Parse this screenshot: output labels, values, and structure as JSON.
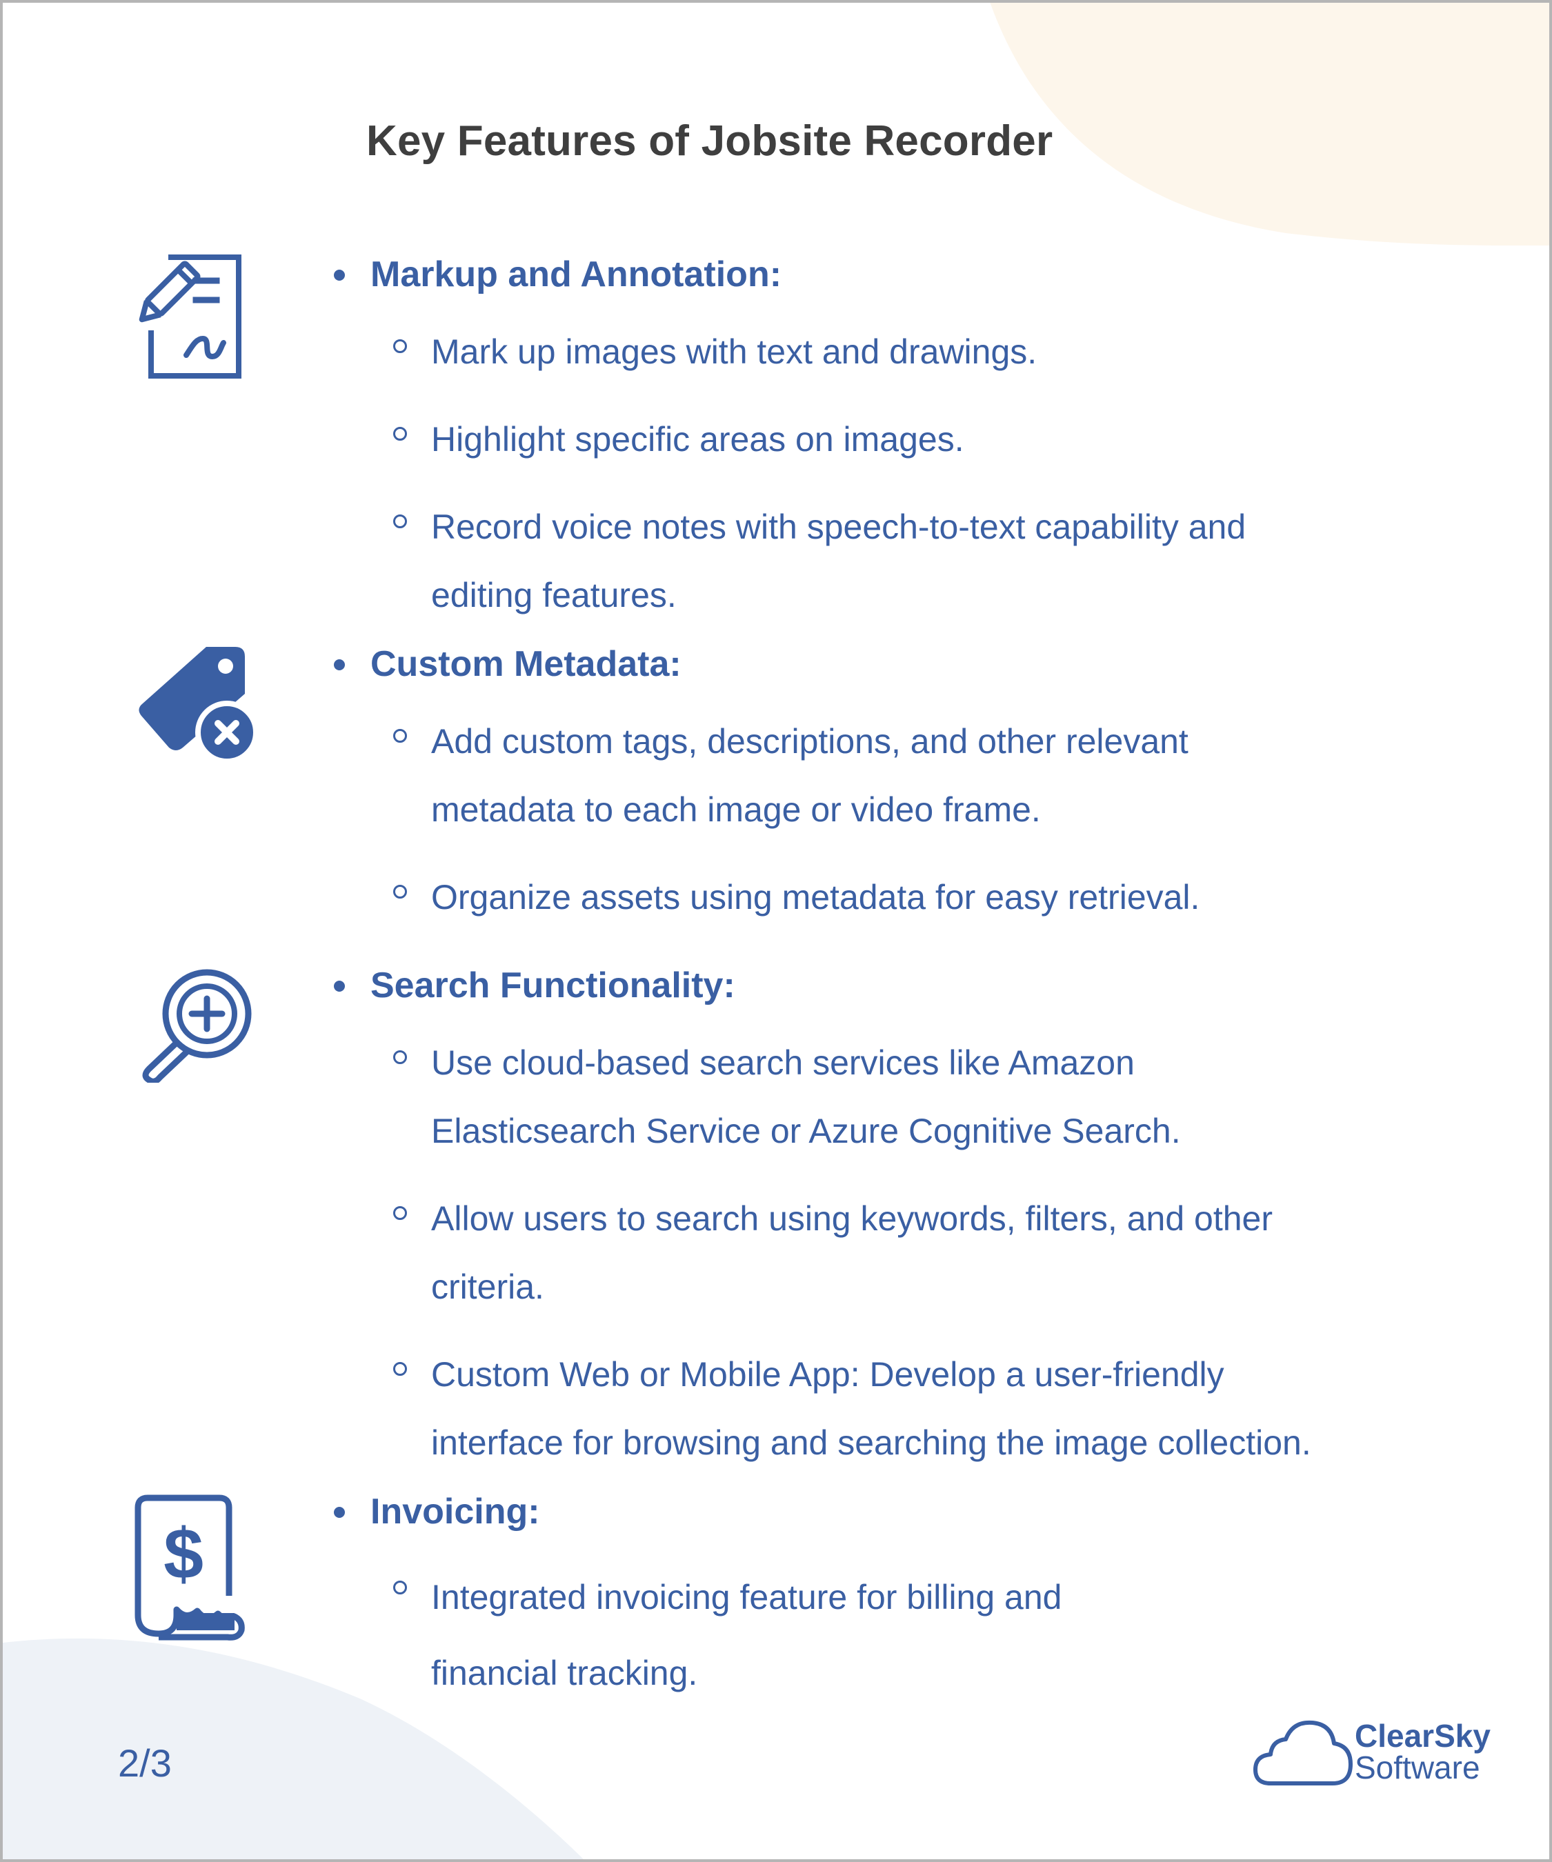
{
  "title": "Key Features of Jobsite Recorder",
  "colors": {
    "accent": "#3a5fa3",
    "title": "#3f3f3f",
    "blob_top": "#fdf6eb",
    "blob_bottom": "#eef2f7"
  },
  "sections": [
    {
      "icon": "document-edit-icon",
      "heading": "Markup and Annotation:",
      "items": [
        [
          "Mark up images with text and drawings."
        ],
        [
          "Highlight specific areas on images."
        ],
        [
          "Record voice notes with speech-to-text capability and",
          "editing features."
        ]
      ]
    },
    {
      "icon": "tag-remove-icon",
      "heading": "Custom Metadata:",
      "items": [
        [
          "Add custom tags, descriptions, and other relevant",
          "metadata to each image or video frame."
        ],
        [
          "Organize assets using metadata for easy retrieval."
        ]
      ]
    },
    {
      "icon": "zoom-in-icon",
      "heading": "Search Functionality:",
      "items": [
        [
          "Use cloud-based search services like Amazon",
          "Elasticsearch Service or Azure Cognitive Search."
        ],
        [
          "Allow users to search using keywords, filters, and other",
          "criteria."
        ],
        [
          "Custom Web or Mobile App: Develop a user-friendly",
          "interface for browsing and searching the image collection."
        ]
      ]
    },
    {
      "icon": "invoice-dollar-icon",
      "heading": "Invoicing:",
      "items": [
        [
          "Integrated invoicing feature for billing and",
          "financial tracking."
        ]
      ]
    }
  ],
  "footer": {
    "page_number": "2/3",
    "logo_line1": "ClearSky",
    "logo_line2": "Software"
  }
}
